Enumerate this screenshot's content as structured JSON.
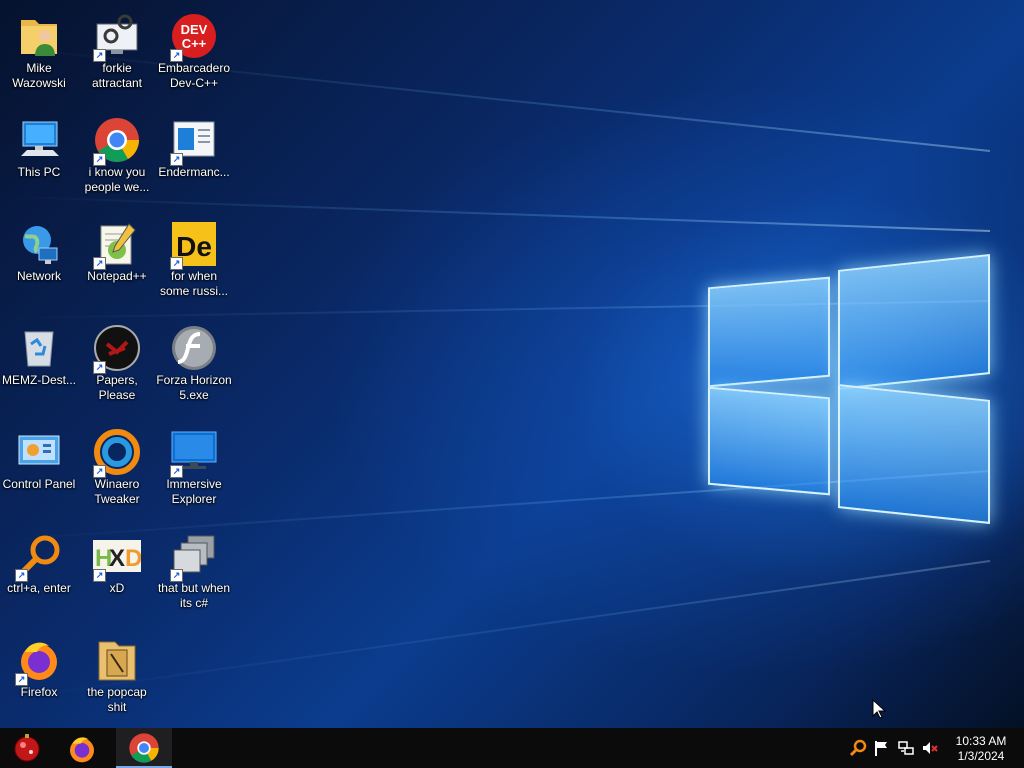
{
  "desktop": {
    "icons": [
      {
        "label": "Mike Wazowski",
        "icon": "user-folder-icon"
      },
      {
        "label": "forkie attractant",
        "icon": "gears-monitor-icon"
      },
      {
        "label": "Embarcadero Dev-C++",
        "icon": "devcpp-icon"
      },
      {
        "label": "This PC",
        "icon": "computer-icon"
      },
      {
        "label": "i know you people we...",
        "icon": "chrome-icon"
      },
      {
        "label": "Endermanc...",
        "icon": "window-app-icon"
      },
      {
        "label": "Network",
        "icon": "network-globe-icon"
      },
      {
        "label": "Notepad++",
        "icon": "notepad-plus-plus-icon"
      },
      {
        "label": "for when some russi...",
        "icon": "de-app-icon"
      },
      {
        "label": "MEMZ-Dest...",
        "icon": "recycle-bin-icon"
      },
      {
        "label": "Papers, Please",
        "icon": "papers-please-icon"
      },
      {
        "label": "Forza Horizon 5.exe",
        "icon": "flash-icon"
      },
      {
        "label": "Control Panel",
        "icon": "control-panel-icon"
      },
      {
        "label": "Winaero Tweaker",
        "icon": "winaero-icon"
      },
      {
        "label": "Immersive Explorer",
        "icon": "monitor-icon"
      },
      {
        "label": "ctrl+a, enter",
        "icon": "magnifier-icon"
      },
      {
        "label": "xD",
        "icon": "hxd-icon"
      },
      {
        "label": "that but when its c#",
        "icon": "stacked-windows-icon"
      },
      {
        "label": "Firefox",
        "icon": "firefox-icon"
      },
      {
        "label": "the popcap shit",
        "icon": "popcap-folder-icon"
      }
    ]
  },
  "taskbar": {
    "buttons": [
      "start-orb-icon",
      "firefox-icon",
      "chrome-icon"
    ],
    "tray": [
      "search-icon",
      "action-center-flag-icon",
      "network-icon",
      "volume-muted-icon"
    ],
    "clock": {
      "time": "10:33 AM",
      "date": "1/3/2024"
    }
  }
}
